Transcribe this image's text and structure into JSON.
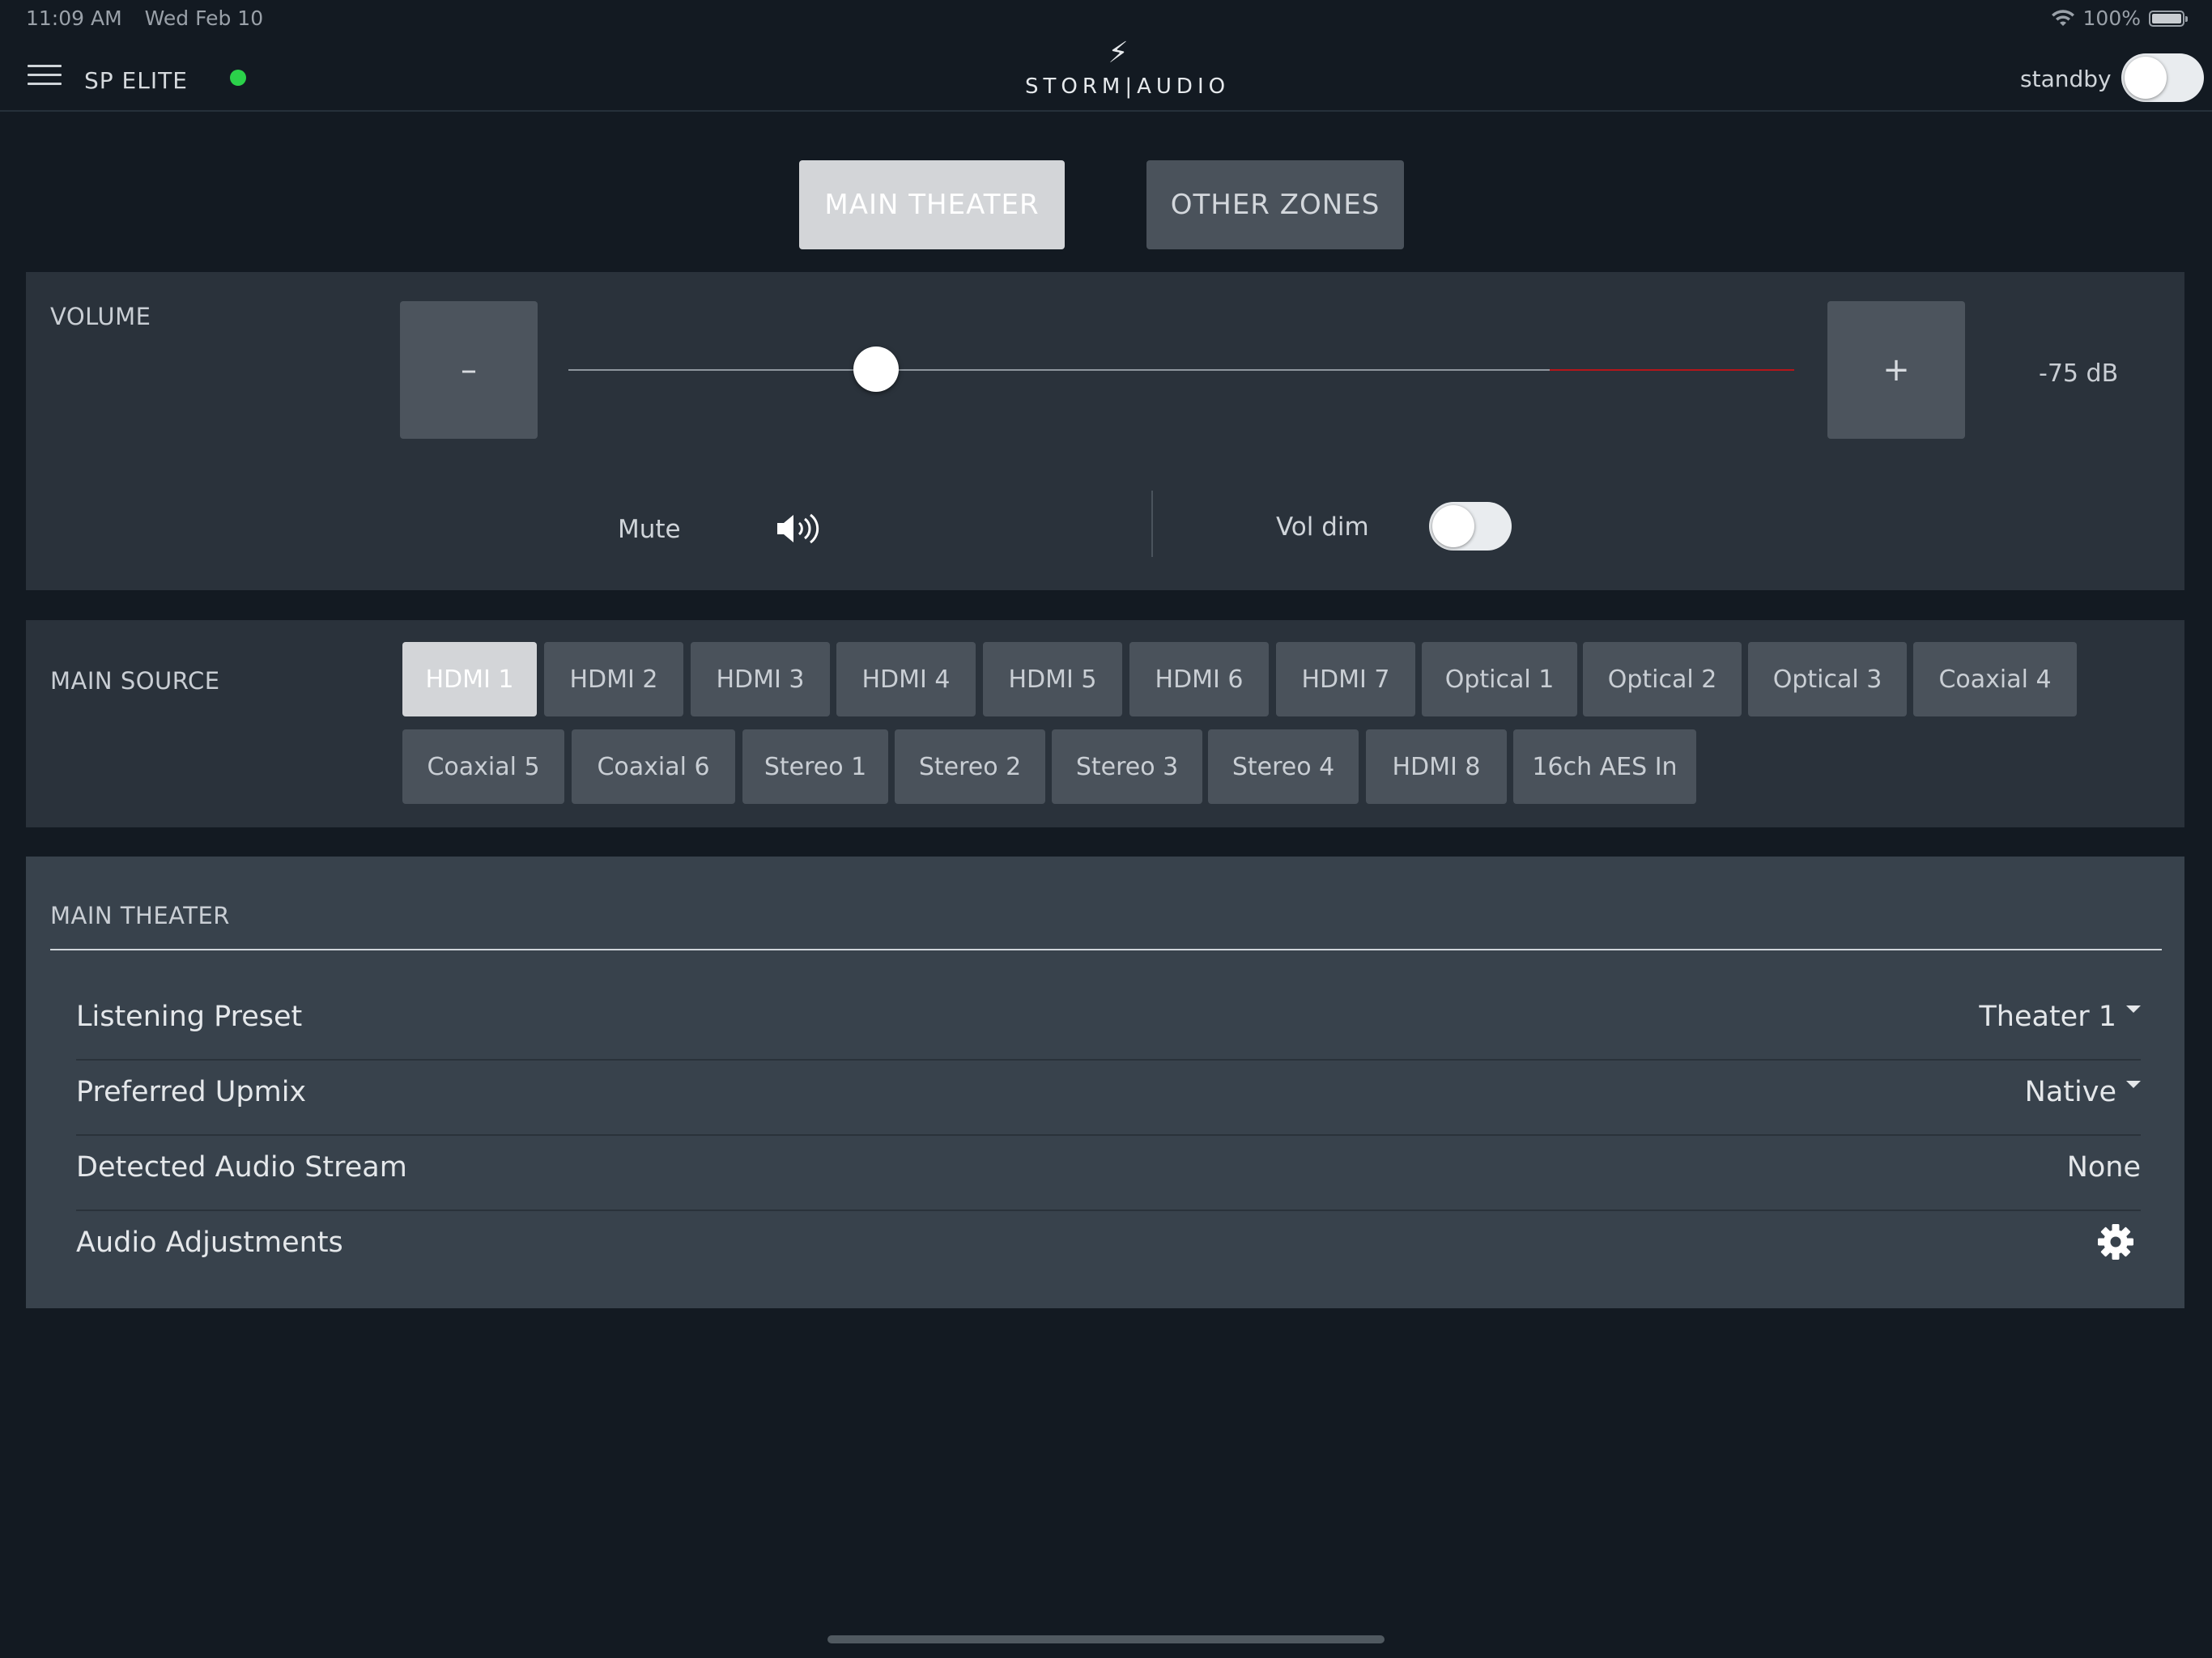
{
  "status_bar": {
    "time": "11:09 AM",
    "date": "Wed Feb 10",
    "battery": "100%",
    "wifi_icon": "wifi-icon",
    "battery_icon": "battery-icon"
  },
  "header": {
    "device_name": "SP ELITE",
    "logo_text": "STORM|AUDIO",
    "standby_label": "standby",
    "standby_on": false,
    "online_color": "#2bd14a"
  },
  "zone_tabs": [
    {
      "label": "MAIN THEATER",
      "active": true
    },
    {
      "label": "OTHER ZONES",
      "active": false
    }
  ],
  "volume": {
    "section_label": "VOLUME",
    "minus_label": "–",
    "plus_label": "+",
    "value_label": "-75 dB",
    "slider_fraction": 0.25,
    "mute_label": "Mute",
    "vol_dim_label": "Vol dim",
    "vol_dim_on": false,
    "accent_red": "#b5161a"
  },
  "main_source": {
    "section_label": "MAIN SOURCE",
    "selected": "HDMI 1",
    "sources": [
      "HDMI 1",
      "HDMI 2",
      "HDMI 3",
      "HDMI 4",
      "HDMI 5",
      "HDMI 6",
      "HDMI 7",
      "Optical 1",
      "Optical 2",
      "Optical 3",
      "Coaxial 4",
      "Coaxial 5",
      "Coaxial 6",
      "Stereo 1",
      "Stereo 2",
      "Stereo 3",
      "Stereo 4",
      "HDMI 8",
      "16ch AES In"
    ]
  },
  "main_theater": {
    "section_label": "MAIN THEATER",
    "rows": [
      {
        "label": "Listening Preset",
        "value": "Theater 1"
      },
      {
        "label": "Preferred Upmix",
        "value": "Native"
      },
      {
        "label": "Detected Audio Stream",
        "value": "None"
      },
      {
        "label": "Audio Adjustments",
        "value": ""
      }
    ]
  }
}
